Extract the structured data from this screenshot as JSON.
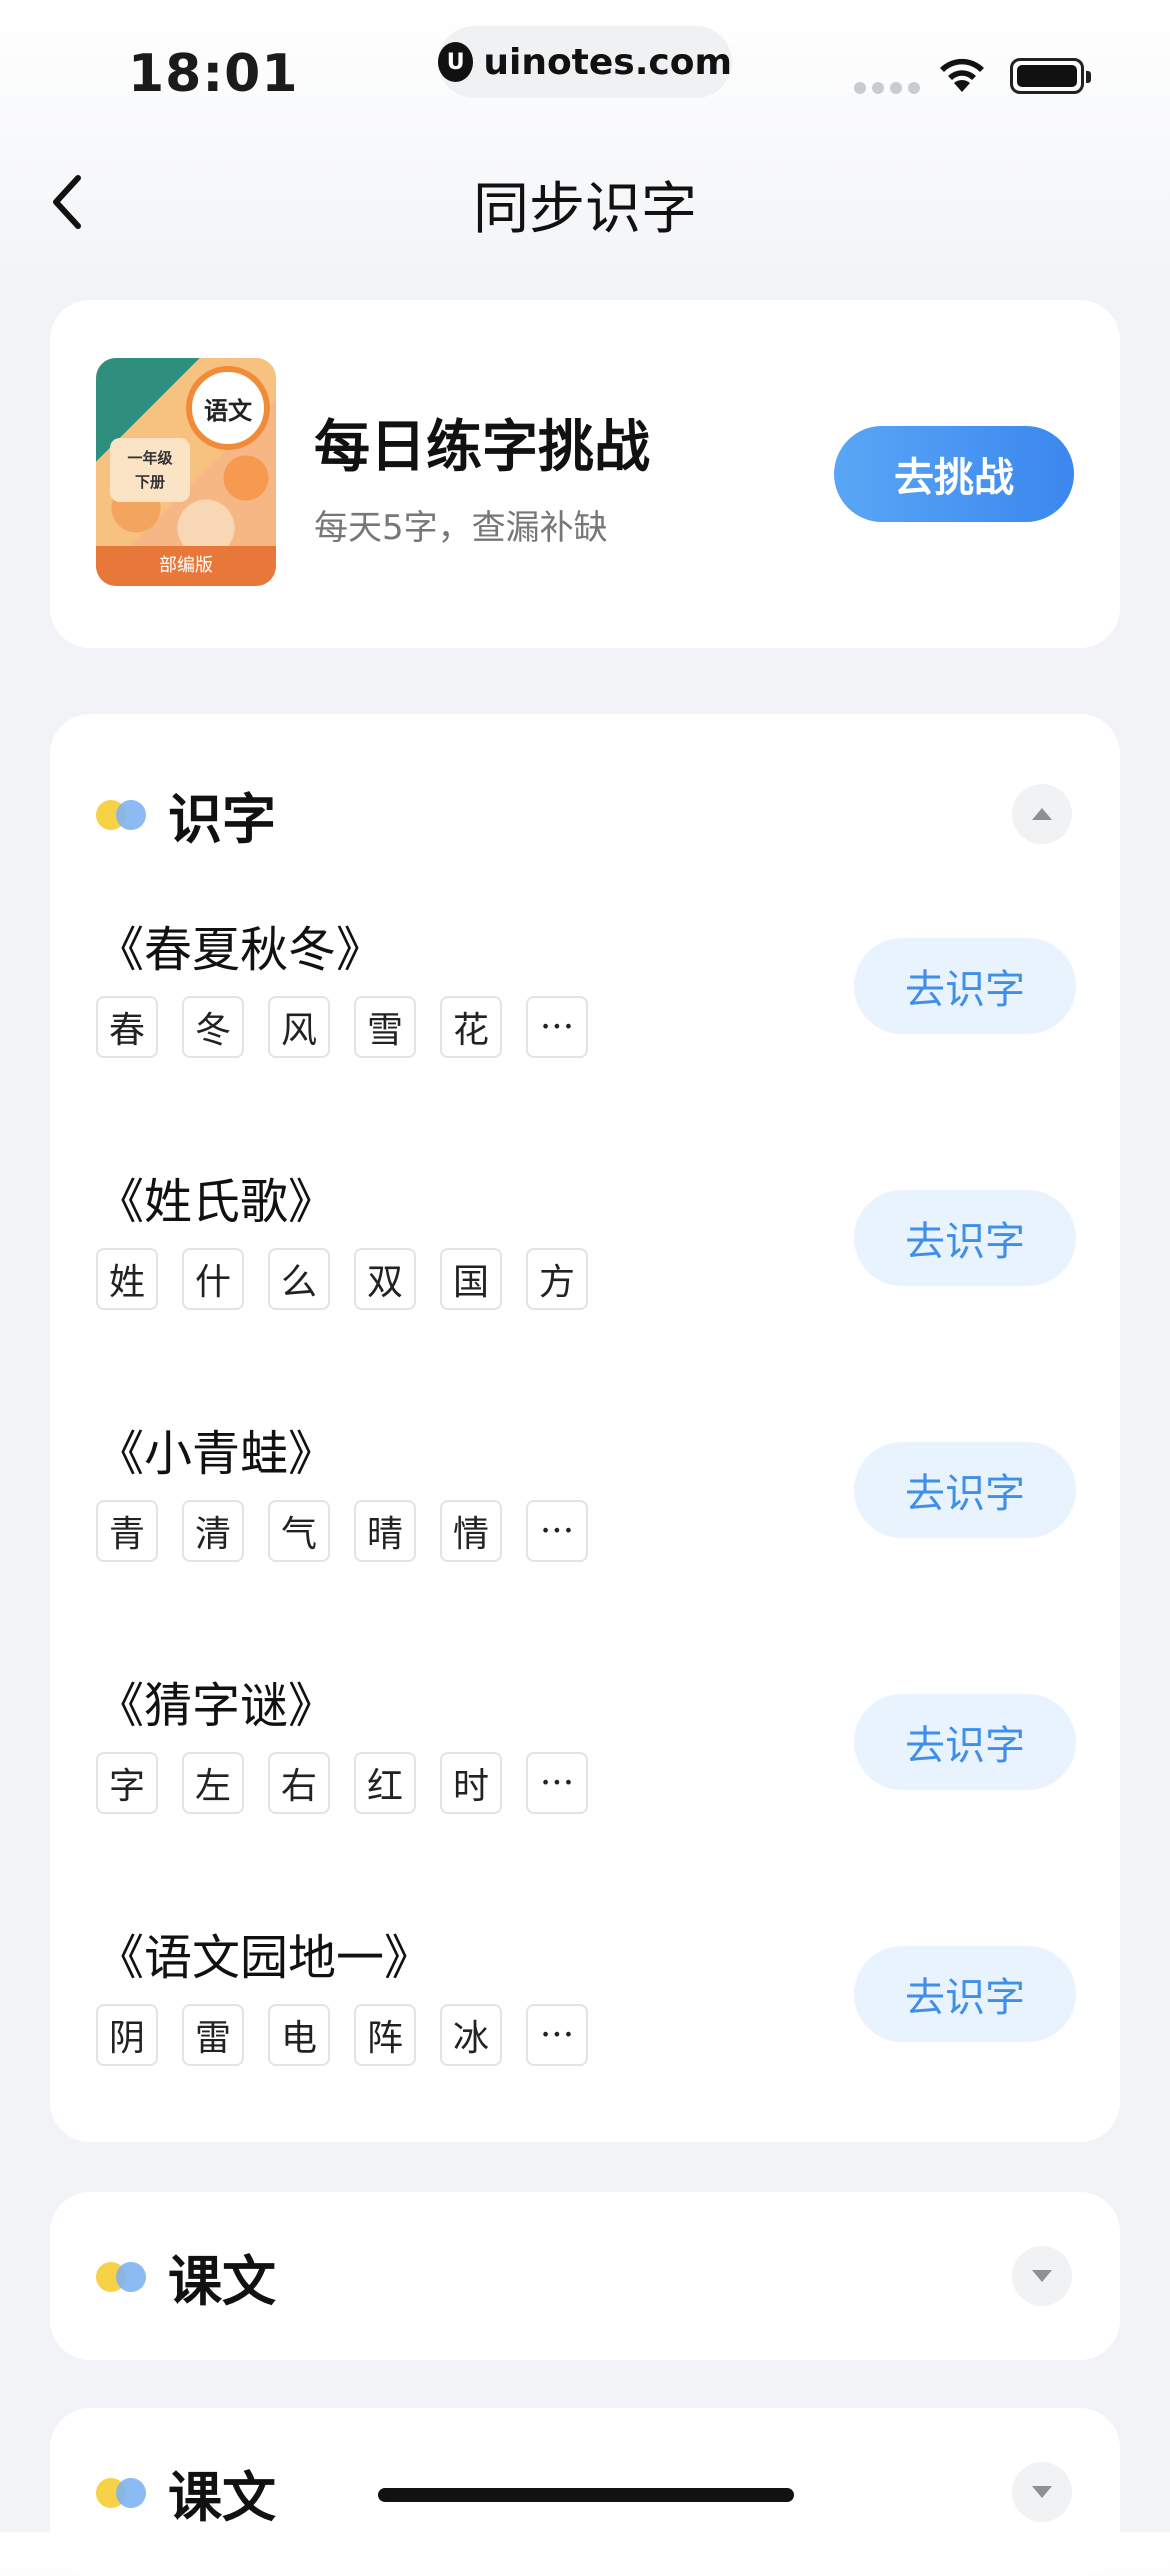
{
  "status": {
    "time": "18:01",
    "site": "uinotes.com"
  },
  "nav": {
    "title": "同步识字"
  },
  "challenge": {
    "book_badge": "语文",
    "book_grade_line1": "一年级",
    "book_grade_line2": "下册",
    "book_edition": "部编版",
    "title": "每日练字挑战",
    "subtitle": "每天5字，查漏补缺",
    "button": "去挑战"
  },
  "section_main": {
    "title": "识字",
    "lessons": [
      {
        "title": "《春夏秋冬》",
        "chars": [
          "春",
          "冬",
          "风",
          "雪",
          "花",
          "···"
        ],
        "button": "去识字"
      },
      {
        "title": "《姓氏歌》",
        "chars": [
          "姓",
          "什",
          "么",
          "双",
          "国",
          "方"
        ],
        "button": "去识字"
      },
      {
        "title": "《小青蛙》",
        "chars": [
          "青",
          "清",
          "气",
          "晴",
          "情",
          "···"
        ],
        "button": "去识字"
      },
      {
        "title": "《猜字谜》",
        "chars": [
          "字",
          "左",
          "右",
          "红",
          "时",
          "···"
        ],
        "button": "去识字"
      },
      {
        "title": "《语文园地一》",
        "chars": [
          "阴",
          "雷",
          "电",
          "阵",
          "冰",
          "···"
        ],
        "button": "去识字"
      }
    ]
  },
  "section_2": {
    "title": "课文"
  },
  "section_3": {
    "title": "课文"
  }
}
